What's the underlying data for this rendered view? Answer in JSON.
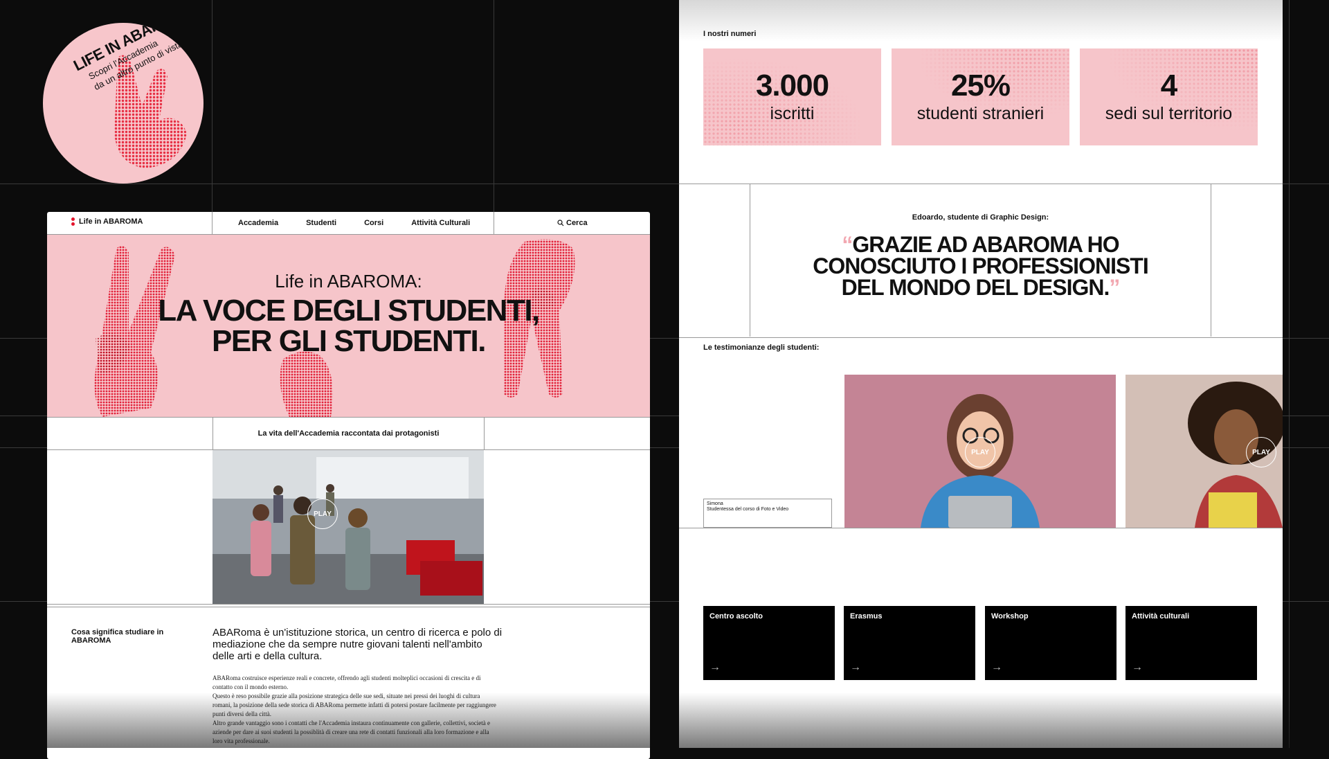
{
  "sticker": {
    "title": "LIFE IN ABAROMA.",
    "line1": "Scopri l'Accademia",
    "line2": "da un altro punto di vista."
  },
  "left_page": {
    "nav": {
      "logo": "Life in ABAROMA",
      "menu": [
        "Accademia",
        "Studenti",
        "Corsi",
        "Attività Culturali"
      ],
      "search": "Cerca"
    },
    "hero": {
      "subtitle": "Life in ABAROMA:",
      "title_line1": "LA VOCE DEGLI STUDENTI,",
      "title_line2": "PER GLI STUDENTI."
    },
    "video": {
      "caption": "La vita dell'Accademia raccontata dai protagonisti",
      "play": "PLAY"
    },
    "about": {
      "heading": "Cosa significa studiare in ABAROMA",
      "lead": "ABARoma è un'istituzione storica, un centro di ricerca e polo di mediazione che da sempre nutre giovani talenti nell'ambito delle arti e della cultura.",
      "p1": "ABARoma costruisce esperienze reali e concrete, offrendo agli studenti molteplici occasioni di crescita e di contatto con il mondo esterno.",
      "p2": "Questo è reso possibile grazie alla posizione strategica delle sue sedi, situate nei pressi dei luoghi di cultura romani, la posizione della sede storica di ABARoma permette infatti di potersi postare facilmente per raggiungere punti diversi della città.",
      "p3": "Altro grande vantaggio sono i contatti che l'Accademia instaura continuamente con gallerie, collettivi, società e aziende per dare ai suoi studenti la possiblità di creare una rete di contatti funzionali alla loro formazione e alla loro vita professionale."
    }
  },
  "right_page": {
    "numbers_label": "I nostri numeri",
    "stats": [
      {
        "value": "3.000",
        "caption": "iscritti"
      },
      {
        "value": "25%",
        "caption": "studenti stranieri"
      },
      {
        "value": "4",
        "caption": "sedi sul territorio"
      }
    ],
    "quote": {
      "author": "Edoardo, studente di Graphic Design:",
      "open": "“",
      "line1": "GRAZIE AD ABAROMA HO",
      "line2": "CONOSCIUTO I PROFESSIONISTI",
      "line3": "DEL MONDO DEL DESIGN.",
      "close": "”"
    },
    "testimonials_label": "Le testimonianze degli studenti:",
    "testimonial_name": "Simona",
    "testimonial_role": "Studentessa del corso di Foto e Video",
    "play": "PLAY",
    "cards": [
      {
        "label": "Centro ascolto",
        "arrow": "→"
      },
      {
        "label": "Erasmus",
        "arrow": "→"
      },
      {
        "label": "Workshop",
        "arrow": "→"
      },
      {
        "label": "Attività culturali",
        "arrow": "→"
      }
    ]
  },
  "colors": {
    "background": "#0c0c0c",
    "pink": "#f6c5ca",
    "accent_red": "#e4142c",
    "card_black": "#000000"
  }
}
